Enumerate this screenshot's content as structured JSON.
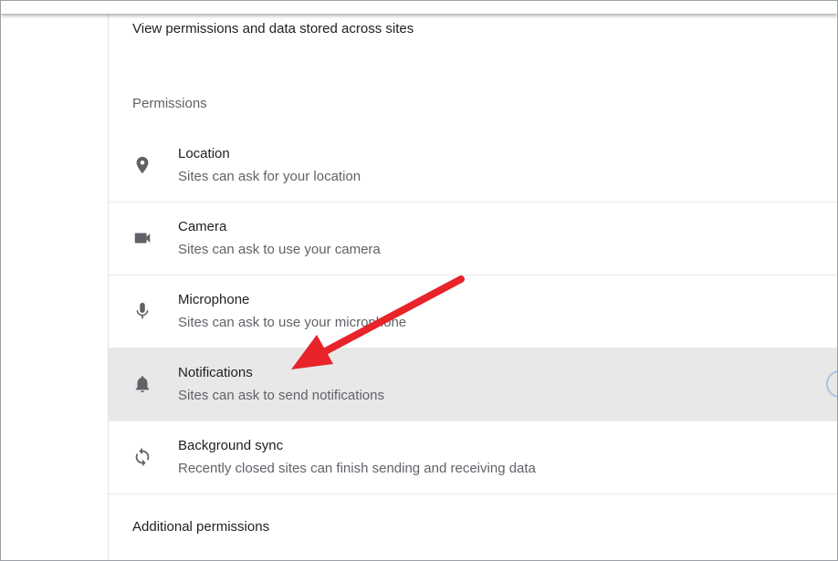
{
  "header": {
    "description": "View permissions and data stored across sites"
  },
  "permissions": {
    "section_title": "Permissions",
    "items": [
      {
        "icon": "location-pin-icon",
        "title": "Location",
        "subtitle": "Sites can ask for your location"
      },
      {
        "icon": "camera-icon",
        "title": "Camera",
        "subtitle": "Sites can ask to use your camera"
      },
      {
        "icon": "microphone-icon",
        "title": "Microphone",
        "subtitle": "Sites can ask to use your microphone"
      },
      {
        "icon": "bell-icon",
        "title": "Notifications",
        "subtitle": "Sites can ask to send notifications"
      },
      {
        "icon": "sync-icon",
        "title": "Background sync",
        "subtitle": "Recently closed sites can finish sending and receiving data"
      }
    ]
  },
  "additional": {
    "label": "Additional permissions"
  },
  "colors": {
    "highlight_row": "#e8e8e8",
    "arrow": "#e8232a",
    "icon": "#5f6368"
  }
}
